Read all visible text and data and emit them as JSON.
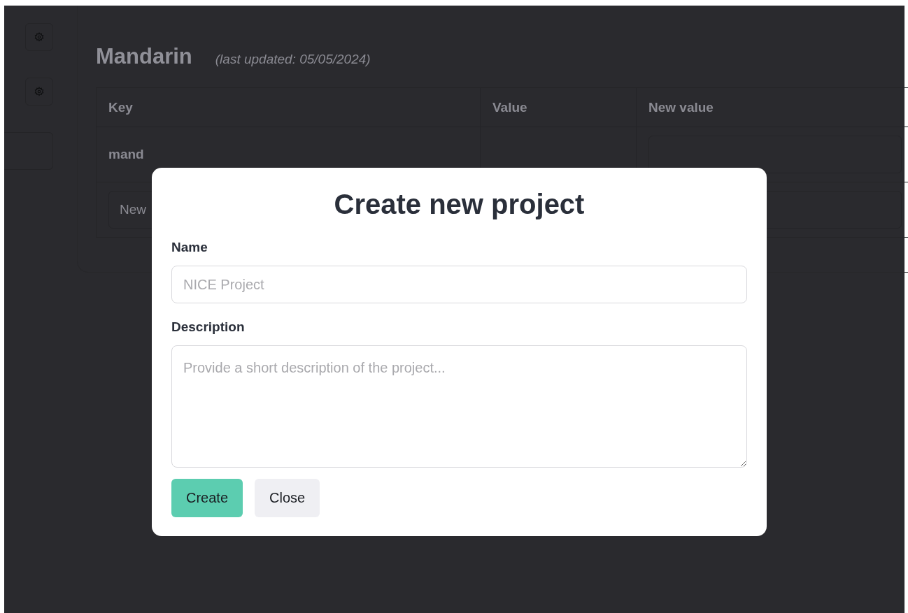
{
  "sidebar": {
    "buttons": [
      {
        "kind": "gear"
      },
      {
        "kind": "gear"
      },
      {
        "kind": "blank"
      }
    ]
  },
  "heading": {
    "title": "Mandarin",
    "subtitle": "(last updated: 05/05/2024)"
  },
  "table": {
    "columns": [
      "Key",
      "Value",
      "New value"
    ],
    "rows": [
      {
        "kind": "entry",
        "key": "mand"
      },
      {
        "kind": "new",
        "placeholder": "New"
      }
    ]
  },
  "modal": {
    "title": "Create new project",
    "fields": [
      {
        "kind": "input",
        "label": "Name",
        "placeholder": "NICE Project"
      },
      {
        "kind": "textarea",
        "label": "Description",
        "placeholder": "Provide a short description of the project..."
      }
    ],
    "buttons": [
      {
        "label": "Create",
        "kind": "primary"
      },
      {
        "label": "Close",
        "kind": "secondary"
      }
    ]
  }
}
